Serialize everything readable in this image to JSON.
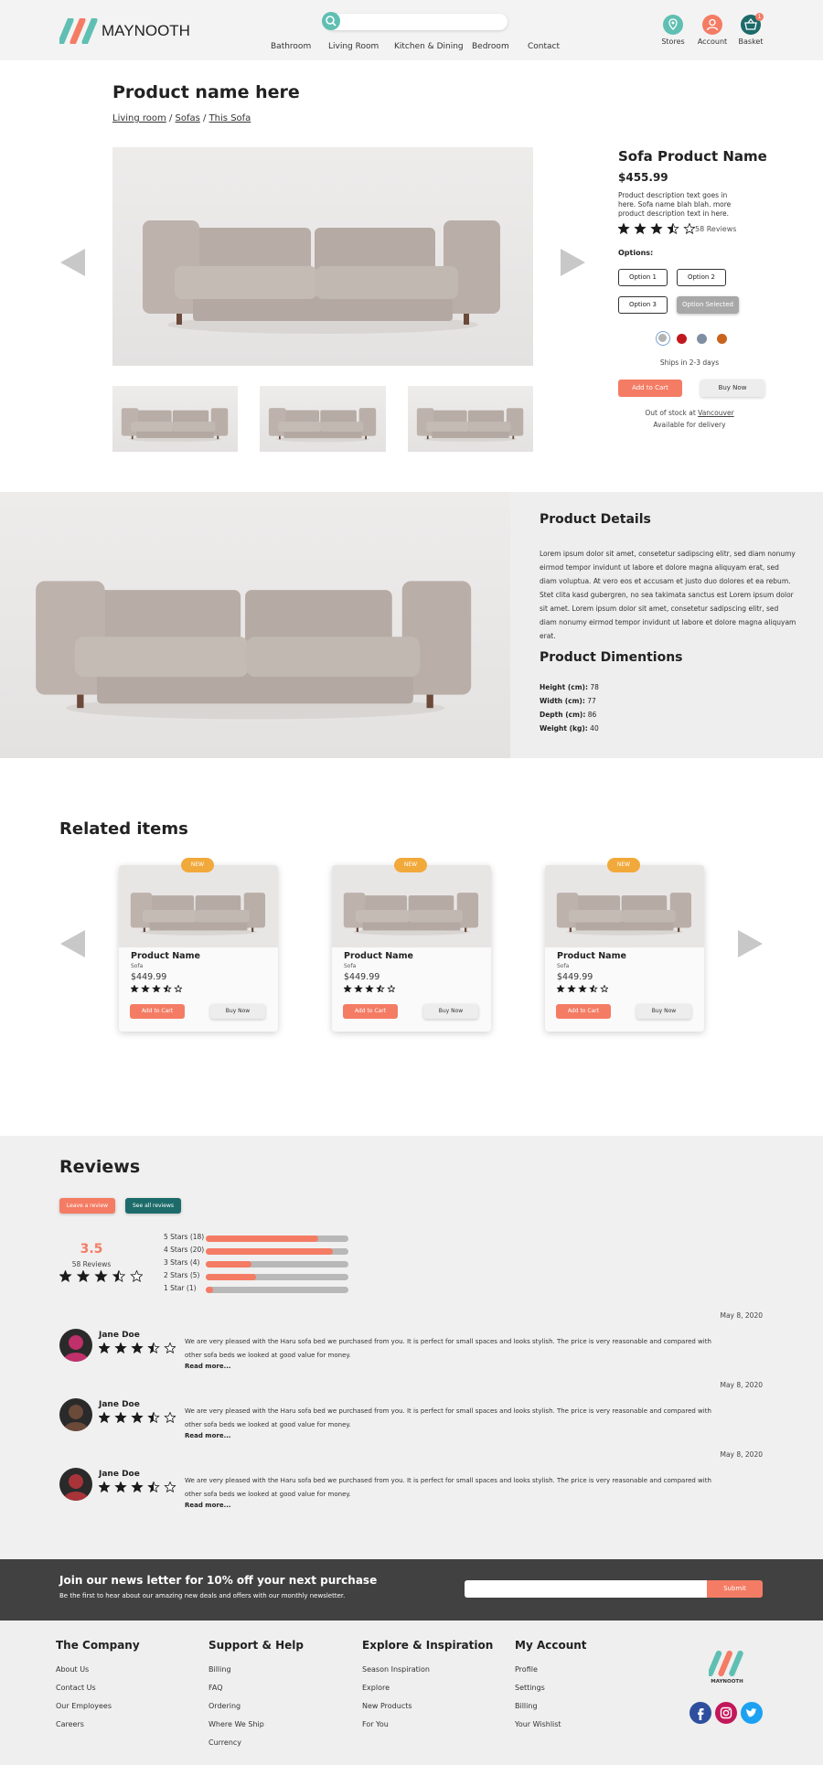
{
  "header": {
    "brand": "MAYNOOTH",
    "search_placeholder": "",
    "nav": [
      "Bathroom",
      "Living Room",
      "Kitchen & Dining",
      "Bedroom",
      "Contact"
    ],
    "icons": [
      {
        "label": "Stores",
        "icon": "location-pin-icon"
      },
      {
        "label": "Account",
        "icon": "person-icon"
      },
      {
        "label": "Basket",
        "icon": "basket-icon"
      }
    ],
    "basket_count": "1",
    "colors": {
      "teal": "#5fbfb2",
      "coral": "#f47c64",
      "dark_teal": "#1c6b6a"
    }
  },
  "product": {
    "page_title": "Product name here",
    "breadcrumb": [
      "Living room",
      "Sofas",
      "This Sofa"
    ],
    "name": "Sofa Product Name",
    "price": "$455.99",
    "description": "Product description text goes in here. Sofa name blah blah. more product description text in here.",
    "rating": 3.5,
    "reviews_label": "58 Reviews",
    "options_label": "Options:",
    "options": [
      "Option 1",
      "Option 2",
      "Option 3",
      "Option Selected"
    ],
    "swatches": [
      "#b3b3b3",
      "#c0191f",
      "#7f8ea1",
      "#c9641f"
    ],
    "ships": "Ships in 2-3 days",
    "add_to_cart": "Add to Cart",
    "buy_now": "Buy Now",
    "stock_text": "Out of stock at",
    "stock_store": "Vancouver",
    "delivery": "Available for delivery"
  },
  "details": {
    "title": "Product Details",
    "body": "Lorem ipsum dolor sit amet, consetetur sadipscing elitr, sed diam nonumy eirmod tempor invidunt ut labore et dolore magna aliquyam erat, sed diam voluptua. At vero eos et accusam et justo duo dolores et ea rebum. Stet clita kasd gubergren, no sea takimata sanctus est Lorem ipsum dolor sit amet. Lorem ipsum dolor sit amet, consetetur sadipscing elitr, sed diam nonumy eirmod tempor invidunt ut labore et dolore magna aliquyam erat.",
    "dims_title": "Product Dimentions",
    "dims": [
      {
        "k": "Height (cm):",
        "v": "78"
      },
      {
        "k": "Width (cm):",
        "v": "77"
      },
      {
        "k": "Depth (cm):",
        "v": "86"
      },
      {
        "k": "Weight (kg):",
        "v": "40"
      }
    ]
  },
  "related": {
    "title": "Related items",
    "items": [
      {
        "badge": "NEW",
        "name": "Product Name",
        "sub": "Sofa",
        "price": "$449.99",
        "rating": 3.5,
        "add": "Add to Cart",
        "buy": "Buy Now"
      },
      {
        "badge": "NEW",
        "name": "Product Name",
        "sub": "Sofa",
        "price": "$449.99",
        "rating": 3.5,
        "add": "Add to Cart",
        "buy": "Buy Now"
      },
      {
        "badge": "NEW",
        "name": "Product Name",
        "sub": "Sofa",
        "price": "$449.99",
        "rating": 3.5,
        "add": "Add to Cart",
        "buy": "Buy Now"
      }
    ]
  },
  "reviews": {
    "title": "Reviews",
    "leave": "Leave a review",
    "see_all": "See all reviews",
    "avg": "3.5",
    "count": "58 Reviews",
    "avg_rating": 3.5,
    "breakdown": [
      {
        "label": "5 Stars (18)",
        "fraction": 0.79
      },
      {
        "label": "4 Stars (20)",
        "fraction": 0.89
      },
      {
        "label": "3 Stars (4)",
        "fraction": 0.32
      },
      {
        "label": "2 Stars (5)",
        "fraction": 0.35
      },
      {
        "label": "1 Star (1)",
        "fraction": 0.05
      }
    ],
    "items": [
      {
        "date": "May 8, 2020",
        "name": "Jane Doe",
        "rating": 3.5,
        "text1": "We are very pleased with the Haru sofa bed we purchased from you. It is perfect for small spaces and looks stylish. The price is very reasonable and compared with",
        "text2": "other sofa beds we looked at good value for money.",
        "more": "Read more...",
        "avatar": "#c0306a"
      },
      {
        "date": "May 8, 2020",
        "name": "Jane Doe",
        "rating": 3.5,
        "text1": "We are very pleased with the Haru sofa bed we purchased from you. It is perfect for small spaces and looks stylish. The price is very reasonable and compared with",
        "text2": "other sofa beds we looked at good value for money.",
        "more": "Read more...",
        "avatar": "#6b4a3a"
      },
      {
        "date": "May 8, 2020",
        "name": "Jane Doe",
        "rating": 3.5,
        "text1": "We are very pleased with the Haru sofa bed we purchased from you. It is perfect for small spaces and looks stylish. The price is very reasonable and compared with",
        "text2": "other sofa beds we looked at good value for money.",
        "more": "Read more...",
        "avatar": "#a8343a"
      }
    ]
  },
  "newsletter": {
    "title": "Join our news letter for 10% off your next purchase",
    "sub": "Be the first to hear about our amazing new deals and offers with our monthly newsletter.",
    "placeholder": "",
    "submit": "Submit"
  },
  "footer": {
    "cols": [
      {
        "title": "The Company",
        "links": [
          "About Us",
          "Contact Us",
          "Our Employees",
          "Careers"
        ]
      },
      {
        "title": "Support & Help",
        "links": [
          "Billing",
          "FAQ",
          "Ordering",
          "Where We Ship",
          "Currency"
        ]
      },
      {
        "title": "Explore & Inspiration",
        "links": [
          "Season Inspiration",
          "Explore",
          "New Products",
          "For You"
        ]
      },
      {
        "title": "My Account",
        "links": [
          "Profile",
          "Settings",
          "Billing",
          "Your Wishlist"
        ]
      }
    ],
    "brand": "MAYNOOTH",
    "social": [
      {
        "icon": "facebook-icon",
        "color": "#2d4f9e"
      },
      {
        "icon": "instagram-icon",
        "color": "#c2185b"
      },
      {
        "icon": "twitter-icon",
        "color": "#1da1f2"
      }
    ]
  }
}
